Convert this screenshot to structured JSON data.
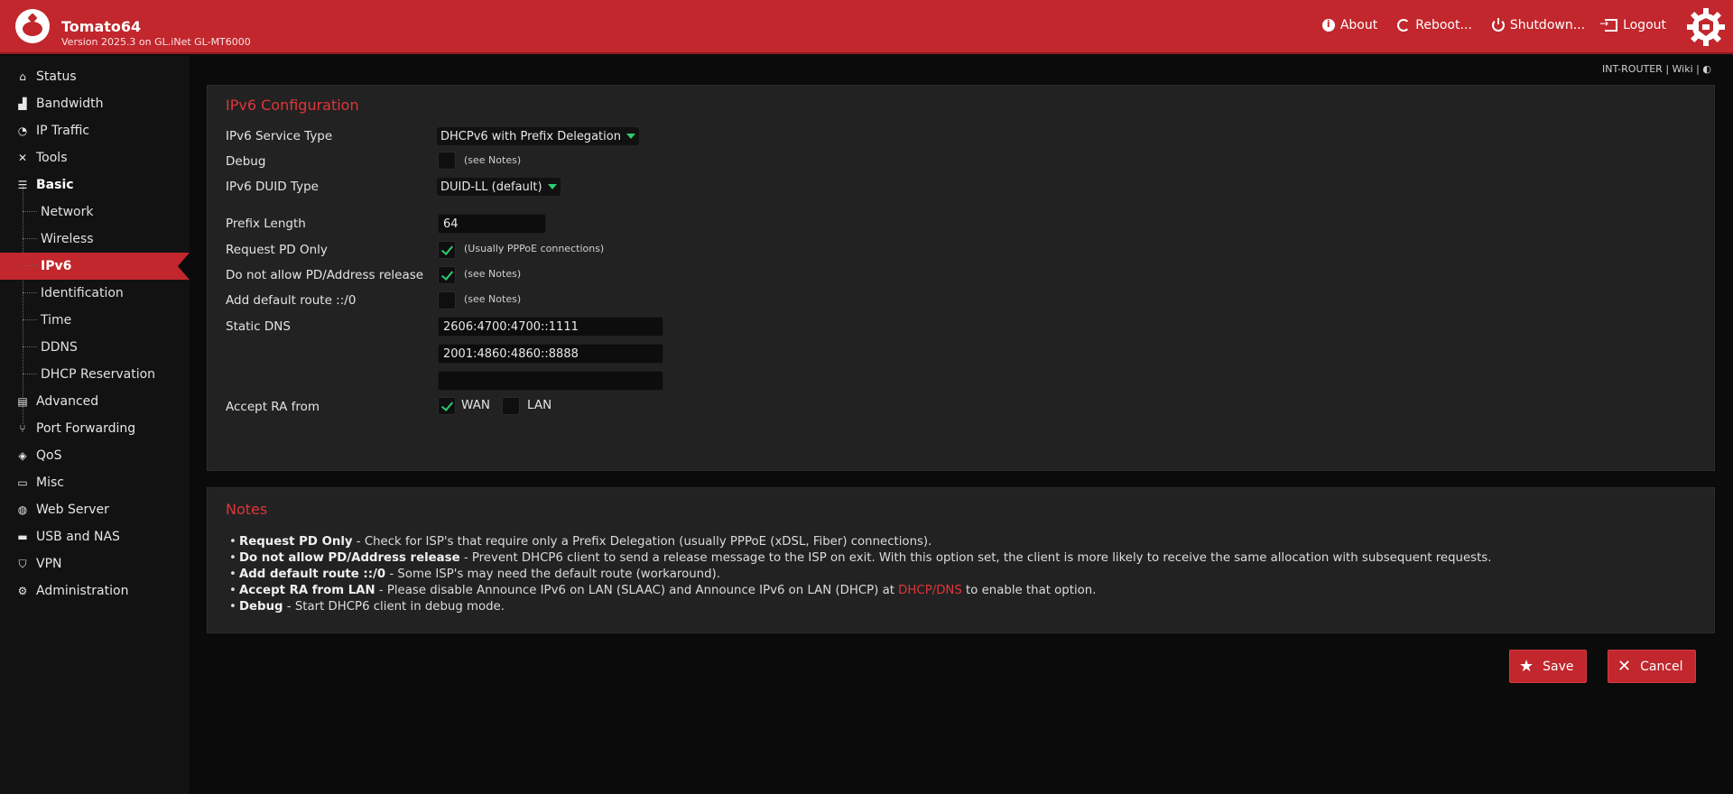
{
  "header": {
    "brand": "Tomato64",
    "version": "Version 2025.3 on GL.iNet GL-MT6000",
    "nav": [
      {
        "label": "About",
        "icon": "info-icon"
      },
      {
        "label": "Reboot...",
        "icon": "reboot-icon"
      },
      {
        "label": "Shutdown...",
        "icon": "power-icon"
      },
      {
        "label": "Logout",
        "icon": "logout-icon"
      }
    ]
  },
  "sidebar": {
    "items": [
      {
        "label": "Status",
        "icon": "home-icon"
      },
      {
        "label": "Bandwidth",
        "icon": "bar-chart-icon"
      },
      {
        "label": "IP Traffic",
        "icon": "pie-icon"
      },
      {
        "label": "Tools",
        "icon": "tools-icon"
      },
      {
        "label": "Basic",
        "icon": "server-icon"
      },
      {
        "label": "Advanced",
        "icon": "advanced-icon"
      },
      {
        "label": "Port Forwarding",
        "icon": "fork-icon"
      },
      {
        "label": "QoS",
        "icon": "tag-icon"
      },
      {
        "label": "Misc",
        "icon": "cast-icon"
      },
      {
        "label": "Web Server",
        "icon": "globe-icon"
      },
      {
        "label": "USB and NAS",
        "icon": "folder-icon"
      },
      {
        "label": "VPN",
        "icon": "shield-icon"
      },
      {
        "label": "Administration",
        "icon": "gear-icon"
      }
    ],
    "basic_sub": [
      "Network",
      "Wireless",
      "IPv6",
      "Identification",
      "Time",
      "DDNS",
      "DHCP Reservation"
    ],
    "active": "IPv6"
  },
  "topright": {
    "host": "INT-ROUTER",
    "sep": "|",
    "wiki": "Wiki",
    "theme": "◐"
  },
  "config": {
    "title": "IPv6 Configuration",
    "service_type_label": "IPv6 Service Type",
    "service_type_value": "DHCPv6 with Prefix Delegation",
    "debug_label": "Debug",
    "debug_checked": false,
    "debug_hint": "(see Notes)",
    "duid_label": "IPv6 DUID Type",
    "duid_value": "DUID-LL (default)",
    "prefix_label": "Prefix Length",
    "prefix_value": "64",
    "request_pd_label": "Request PD Only",
    "request_pd_checked": true,
    "request_pd_hint": "(Usually PPPoE connections)",
    "no_release_label": "Do not allow PD/Address release",
    "no_release_checked": true,
    "no_release_hint": "(see Notes)",
    "default_route_label": "Add default route ::/0",
    "default_route_checked": false,
    "default_route_hint": "(see Notes)",
    "static_dns_label": "Static DNS",
    "dns": [
      "2606:4700:4700::1111",
      "2001:4860:4860::8888",
      ""
    ],
    "accept_ra_label": "Accept RA from",
    "accept_ra_wan": "WAN",
    "accept_ra_wan_checked": true,
    "accept_ra_lan": "LAN",
    "accept_ra_lan_checked": false
  },
  "notes": {
    "title": "Notes",
    "items": [
      {
        "term": "Request PD Only",
        "text": " - Check for ISP's that require only a Prefix Delegation (usually PPPoE (xDSL, Fiber) connections)."
      },
      {
        "term": "Do not allow PD/Address release",
        "text": " - Prevent DHCP6 client to send a release message to the ISP on exit. With this option set, the client is more likely to receive the same allocation with subsequent requests."
      },
      {
        "term": "Add default route ::/0",
        "text": " - Some ISP's may need the default route (workaround)."
      },
      {
        "term": "Accept RA from LAN",
        "text": " - Please disable Announce IPv6 on LAN (SLAAC) and Announce IPv6 on LAN (DHCP) at ",
        "link": "DHCP/DNS",
        "tail": " to enable that option."
      },
      {
        "term": "Debug",
        "text": " - Start DHCP6 client in debug mode."
      }
    ]
  },
  "buttons": {
    "save": "Save",
    "cancel": "Cancel"
  },
  "colors": {
    "accent": "#c1272d",
    "check": "#2ecc71",
    "panel": "#222222",
    "background": "#0b0b0b"
  }
}
